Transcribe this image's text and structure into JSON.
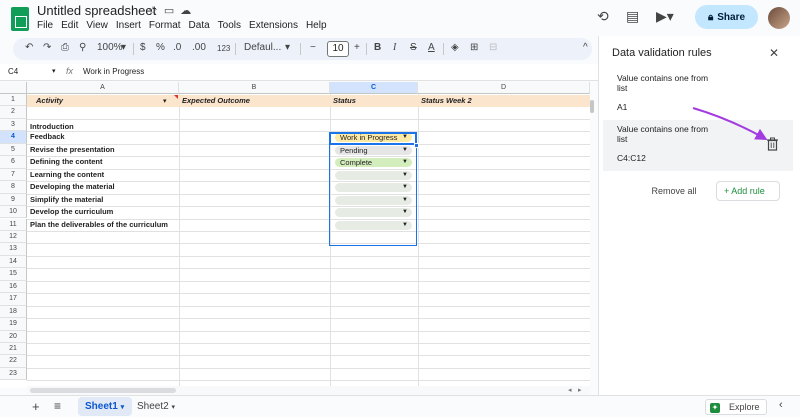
{
  "app": {
    "doc_title": "Untitled spreadsheet",
    "menus": [
      "File",
      "Edit",
      "View",
      "Insert",
      "Format",
      "Data",
      "Tools",
      "Extensions",
      "Help"
    ],
    "share_label": "Share"
  },
  "toolbar": {
    "zoom": "100%",
    "currency": "$",
    "percent": "%",
    "decimal_dec": ".0",
    "decimal_inc": ".00",
    "number_format": "123",
    "font": "Defaul...",
    "font_size": "10"
  },
  "formula_bar": {
    "cell_ref": "C4",
    "value": "Work in Progress"
  },
  "columns": [
    "A",
    "B",
    "C",
    "D"
  ],
  "rows": [
    "1",
    "2",
    "3",
    "4",
    "5",
    "6",
    "7",
    "8",
    "9",
    "10",
    "11",
    "12",
    "13",
    "14",
    "15",
    "16",
    "17",
    "18",
    "19",
    "20",
    "21",
    "22",
    "23"
  ],
  "header_row": {
    "activity": "Activity",
    "expected": "Expected Outcome",
    "status": "Status",
    "status_week2": "Status Week 2"
  },
  "cells": {
    "introduction": "Introduction",
    "activities": [
      "Feedback",
      "Revise the presentation",
      "Defining the content",
      "Learning the content",
      "Developing the material",
      "Simplify the material",
      "Develop the curriculum",
      "Plan the deliverables of the curriculum"
    ],
    "statuses": [
      "Work in Progress",
      "Pending",
      "Complete",
      "",
      "",
      "",
      "",
      ""
    ]
  },
  "colors": {
    "header_fill": "#fce5cd",
    "wip_chip": "#fbe9a6",
    "pending_chip": "#e6e6e6",
    "complete_chip": "#d4edbc",
    "empty_chip": "#e6ebe4",
    "accent": "#a23be0"
  },
  "sheets": {
    "tab1": "Sheet1",
    "tab2": "Sheet2",
    "explore": "Explore"
  },
  "panel": {
    "title": "Data validation rules",
    "rules": [
      {
        "desc": "Value contains one from list",
        "range": "A1"
      },
      {
        "desc": "Value contains one from list",
        "range": "C4:C12"
      }
    ],
    "remove_all": "Remove all",
    "add_rule": "+ Add rule"
  }
}
